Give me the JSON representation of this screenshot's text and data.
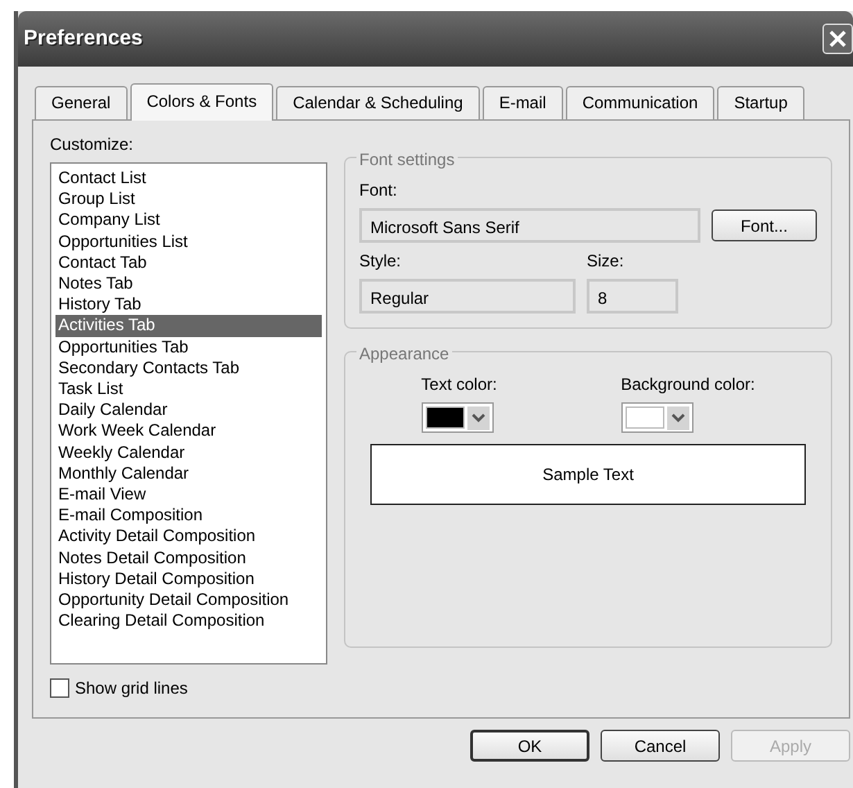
{
  "window": {
    "title": "Preferences"
  },
  "tabs": [
    {
      "label": "General",
      "selected": false
    },
    {
      "label": "Colors & Fonts",
      "selected": true
    },
    {
      "label": "Calendar & Scheduling",
      "selected": false
    },
    {
      "label": "E-mail",
      "selected": false
    },
    {
      "label": "Communication",
      "selected": false
    },
    {
      "label": "Startup",
      "selected": false
    }
  ],
  "customize": {
    "label": "Customize:",
    "items": [
      {
        "label": "Contact List",
        "selected": false
      },
      {
        "label": "Group List",
        "selected": false
      },
      {
        "label": "Company List",
        "selected": false
      },
      {
        "label": "Opportunities List",
        "selected": false
      },
      {
        "label": "Contact Tab",
        "selected": false
      },
      {
        "label": "Notes Tab",
        "selected": false
      },
      {
        "label": "History Tab",
        "selected": false
      },
      {
        "label": "Activities Tab",
        "selected": true
      },
      {
        "label": "Opportunities Tab",
        "selected": false
      },
      {
        "label": "Secondary Contacts Tab",
        "selected": false
      },
      {
        "label": "Task List",
        "selected": false
      },
      {
        "label": "Daily Calendar",
        "selected": false
      },
      {
        "label": "Work Week Calendar",
        "selected": false
      },
      {
        "label": "Weekly Calendar",
        "selected": false
      },
      {
        "label": "Monthly Calendar",
        "selected": false
      },
      {
        "label": "E-mail View",
        "selected": false
      },
      {
        "label": "E-mail Composition",
        "selected": false
      },
      {
        "label": "Activity Detail Composition",
        "selected": false
      },
      {
        "label": "Notes Detail Composition",
        "selected": false
      },
      {
        "label": "History Detail Composition",
        "selected": false
      },
      {
        "label": "Opportunity Detail Composition",
        "selected": false
      },
      {
        "label": "Clearing Detail Composition",
        "selected": false
      }
    ]
  },
  "show_grid_lines": {
    "label": "Show grid lines",
    "checked": false
  },
  "font_settings": {
    "title": "Font settings",
    "font_label": "Font:",
    "font_value": "Microsoft Sans Serif",
    "font_button": "Font...",
    "style_label": "Style:",
    "style_value": "Regular",
    "size_label": "Size:",
    "size_value": "8"
  },
  "appearance": {
    "title": "Appearance",
    "text_color": {
      "label": "Text color:",
      "color": "#000000"
    },
    "background_color": {
      "label": "Background color:",
      "color": "#ffffff"
    },
    "sample_text": "Sample Text"
  },
  "buttons": [
    {
      "label": "OK",
      "disabled": false,
      "default": true
    },
    {
      "label": "Cancel",
      "disabled": false,
      "default": false
    },
    {
      "label": "Apply",
      "disabled": true,
      "default": false
    }
  ]
}
